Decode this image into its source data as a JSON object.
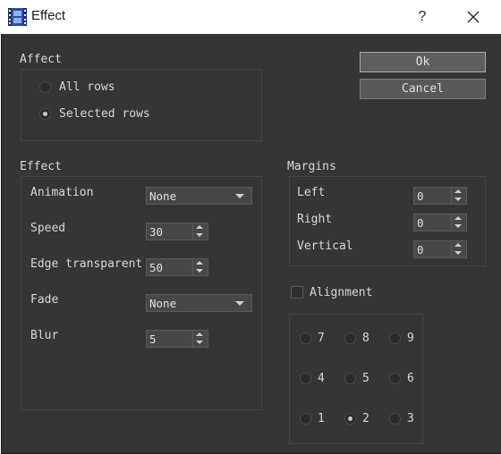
{
  "window": {
    "title": "Effect",
    "help_label": "?"
  },
  "affect": {
    "label": "Affect",
    "options": [
      {
        "label": "All rows",
        "checked": false
      },
      {
        "label": "Selected rows",
        "checked": true
      }
    ]
  },
  "buttons": {
    "ok": "Ok",
    "cancel": "Cancel"
  },
  "effect": {
    "label": "Effect",
    "animation": {
      "label": "Animation",
      "value": "None"
    },
    "speed": {
      "label": "Speed",
      "value": "30"
    },
    "edge": {
      "label": "Edge transparent",
      "value": "50"
    },
    "fade": {
      "label": "Fade",
      "value": "None"
    },
    "blur": {
      "label": "Blur",
      "value": "5"
    }
  },
  "margins": {
    "label": "Margins",
    "left": {
      "label": "Left",
      "value": "0"
    },
    "right": {
      "label": "Right",
      "value": "0"
    },
    "vertical": {
      "label": "Vertical",
      "value": "0"
    }
  },
  "alignment": {
    "label": "Alignment",
    "checked": false,
    "selected": "2",
    "options": [
      "7",
      "8",
      "9",
      "4",
      "5",
      "6",
      "1",
      "2",
      "3"
    ]
  },
  "colors": {
    "background": "#353535",
    "text": "#d8d8d8",
    "field": "#474747",
    "button": "#595959"
  },
  "icons": {
    "app": "film-icon",
    "help": "help-icon",
    "close": "close-icon"
  }
}
